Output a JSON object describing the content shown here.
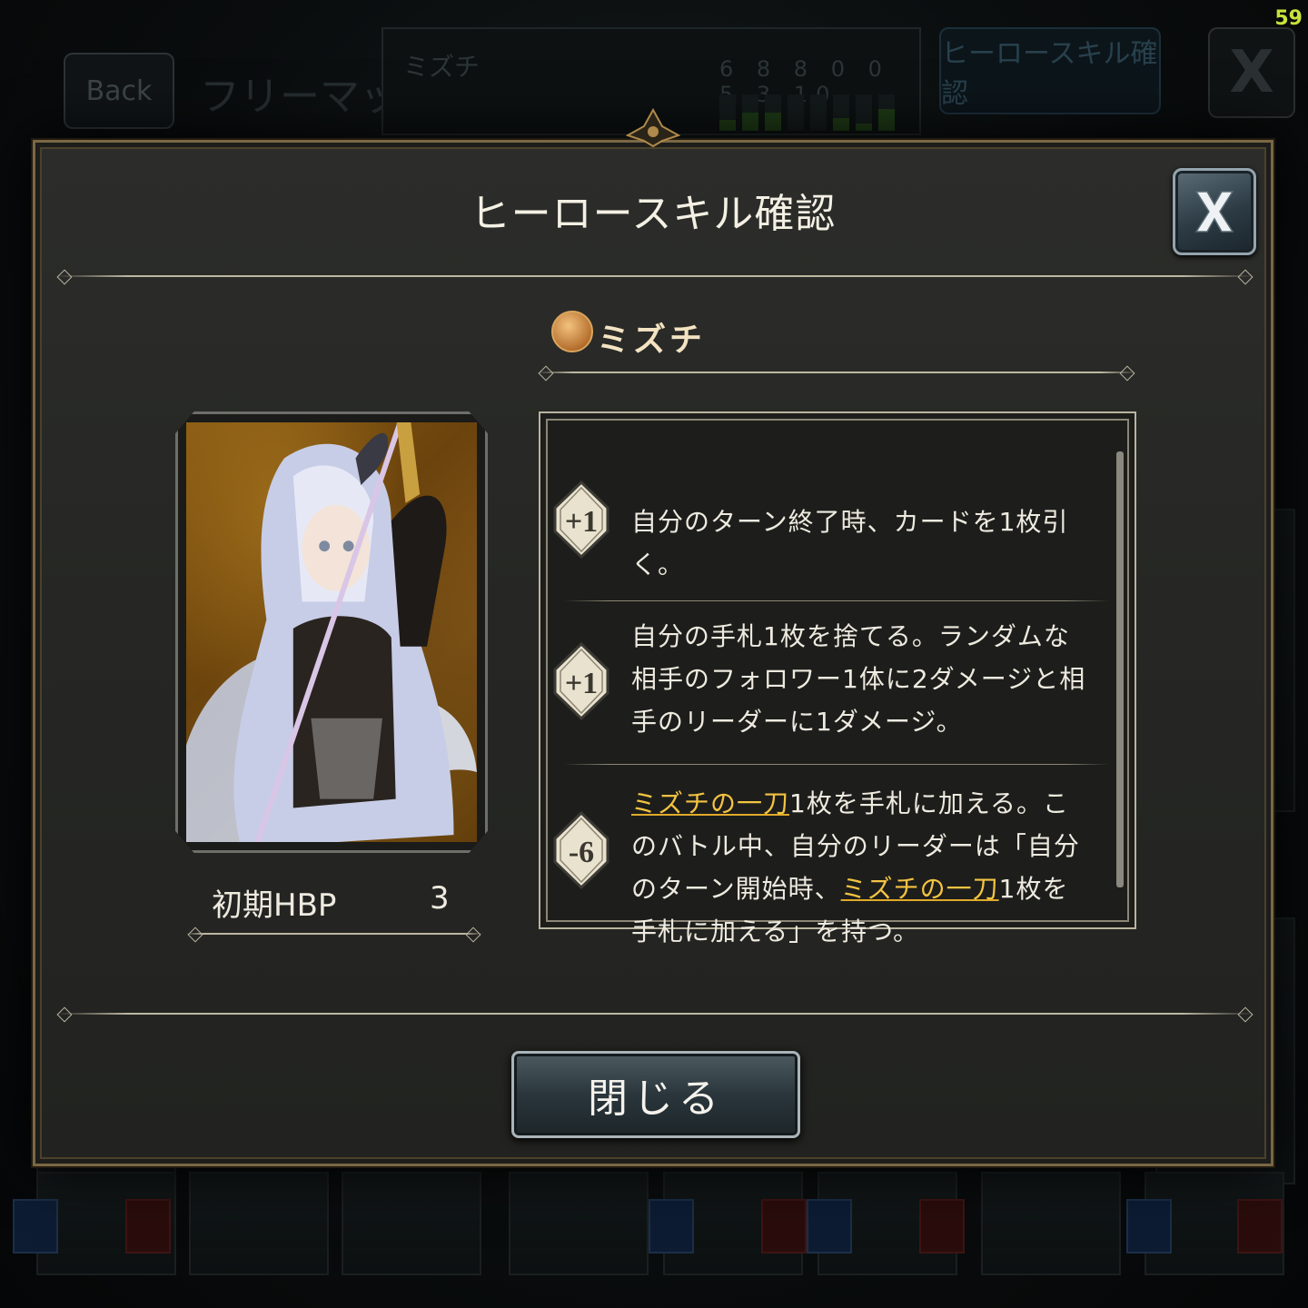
{
  "fps": "59",
  "background": {
    "back_label": "Back",
    "screen_title": "フリーマッチ",
    "deck_name": "ミズチ",
    "cost_numbers": "6 8 8 0 0 5 3 10",
    "hero_skill_button": "ヒーロースキル確認",
    "close_symbol": "X"
  },
  "modal": {
    "title": "ヒーロースキル確認",
    "hero_name": "ミズチ",
    "hbp_label": "初期HBP",
    "hbp_value": "3",
    "close_button": "閉じる"
  },
  "skills": [
    {
      "cost": "+1",
      "parts": [
        {
          "text": "自分のターン終了時、カードを1枚引く。",
          "highlight": false
        }
      ]
    },
    {
      "cost": "+1",
      "parts": [
        {
          "text": "自分の手札1枚を捨てる。ランダムな相手のフォロワー1体に2ダメージと相手のリーダーに1ダメージ。",
          "highlight": false
        }
      ]
    },
    {
      "cost": "-6",
      "parts": [
        {
          "text": "ミズチの一刀",
          "highlight": true
        },
        {
          "text": "1枚を手札に加える。このバトル中、自分のリーダーは「自分のターン開始時、",
          "highlight": false
        },
        {
          "text": "ミズチの一刀",
          "highlight": true
        },
        {
          "text": "1枚を手札に加える」を持つ。",
          "highlight": false
        }
      ]
    }
  ],
  "colors": {
    "highlight": "#f3c342",
    "frame_gold": "#7a6743",
    "badge_fill": "#e8e2cf"
  }
}
